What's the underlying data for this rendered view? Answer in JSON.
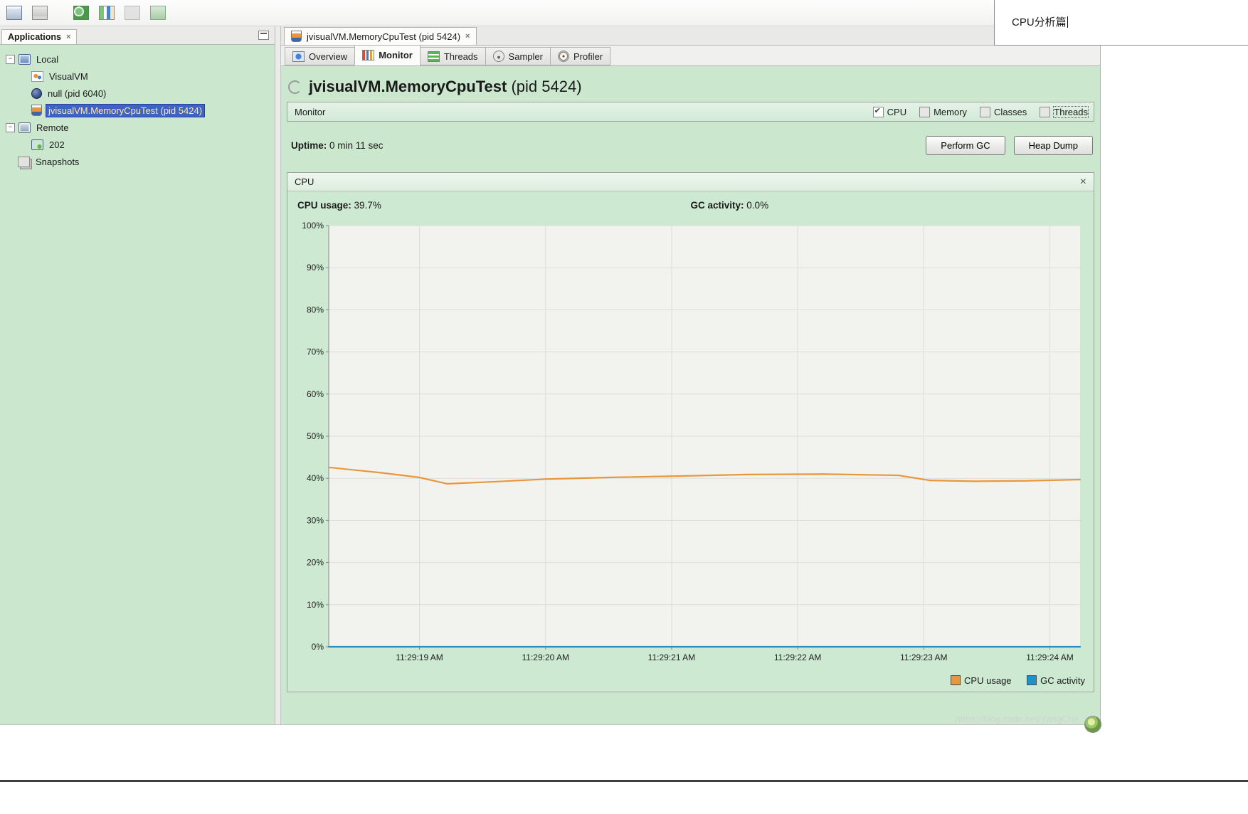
{
  "app_title": "VisualVM",
  "toolbar": {
    "icons": [
      "load-snapshot-icon",
      "save-icon",
      "add-jmx-connection-icon",
      "application-snapshot-icon",
      "heap-dump-icon",
      "thread-dump-icon"
    ]
  },
  "note_overlay": {
    "text": "CPU分析篇"
  },
  "sidebar": {
    "tab_label": "Applications",
    "tree": [
      {
        "label": "Local"
      },
      {
        "label": "VisualVM"
      },
      {
        "label": "null (pid 6040)"
      },
      {
        "label": "jvisualVM.MemoryCpuTest (pid 5424)"
      },
      {
        "label": "Remote"
      },
      {
        "label": "202"
      },
      {
        "label": "Snapshots"
      }
    ]
  },
  "main": {
    "document_tab": {
      "label": "jvisualVM.MemoryCpuTest (pid 5424)"
    },
    "view_tabs": [
      {
        "label": "Overview",
        "active": false
      },
      {
        "label": "Monitor",
        "active": true
      },
      {
        "label": "Threads",
        "active": false
      },
      {
        "label": "Sampler",
        "active": false
      },
      {
        "label": "Profiler",
        "active": false
      }
    ],
    "heading": {
      "title": "jvisualVM.MemoryCpuTest",
      "pid": "(pid 5424)"
    },
    "monitor_bar": {
      "label": "Monitor",
      "checkboxes": [
        {
          "label": "CPU",
          "checked": true
        },
        {
          "label": "Memory",
          "checked": false
        },
        {
          "label": "Classes",
          "checked": false
        },
        {
          "label": "Threads",
          "checked": false
        }
      ]
    },
    "uptime": {
      "label": "Uptime:",
      "value": "0 min 11 sec"
    },
    "actions": [
      {
        "label": "Perform GC"
      },
      {
        "label": "Heap Dump"
      }
    ],
    "cpu_panel": {
      "title": "CPU",
      "stats": [
        {
          "label": "CPU usage:",
          "value": "39.7%"
        },
        {
          "label": "GC activity:",
          "value": "0.0%"
        }
      ]
    }
  },
  "footer": {
    "watermark": "https://blog.csdn.net/YangChe"
  },
  "chart_data": {
    "type": "line",
    "title": "CPU",
    "xlabel": "",
    "ylabel": "",
    "ylim": [
      0,
      100
    ],
    "yticks": [
      0,
      10,
      20,
      30,
      40,
      50,
      60,
      70,
      80,
      90,
      100
    ],
    "ytick_suffix": "%",
    "x_range": [
      18.28,
      24.24
    ],
    "xticks": [
      19,
      20,
      21,
      22,
      23,
      24
    ],
    "x_tick_labels": [
      "11:29:19 AM",
      "11:29:20 AM",
      "11:29:21 AM",
      "11:29:22 AM",
      "11:29:23 AM",
      "11:29:24 AM"
    ],
    "grid": true,
    "plot_bg": "#f2f2ef",
    "legend_position": "bottom-right",
    "series": [
      {
        "name": "CPU usage",
        "color": "#e8973c",
        "x": [
          18.28,
          18.7,
          19.0,
          19.22,
          19.6,
          20.0,
          20.5,
          21.0,
          21.6,
          22.2,
          22.8,
          23.05,
          23.4,
          23.8,
          24.24
        ],
        "values": [
          42.6,
          41.3,
          40.2,
          38.7,
          39.2,
          39.8,
          40.2,
          40.5,
          40.9,
          41.0,
          40.7,
          39.5,
          39.3,
          39.4,
          39.7
        ]
      },
      {
        "name": "GC activity",
        "color": "#2191c9",
        "x": [
          18.28,
          24.24
        ],
        "values": [
          0,
          0
        ]
      }
    ]
  }
}
